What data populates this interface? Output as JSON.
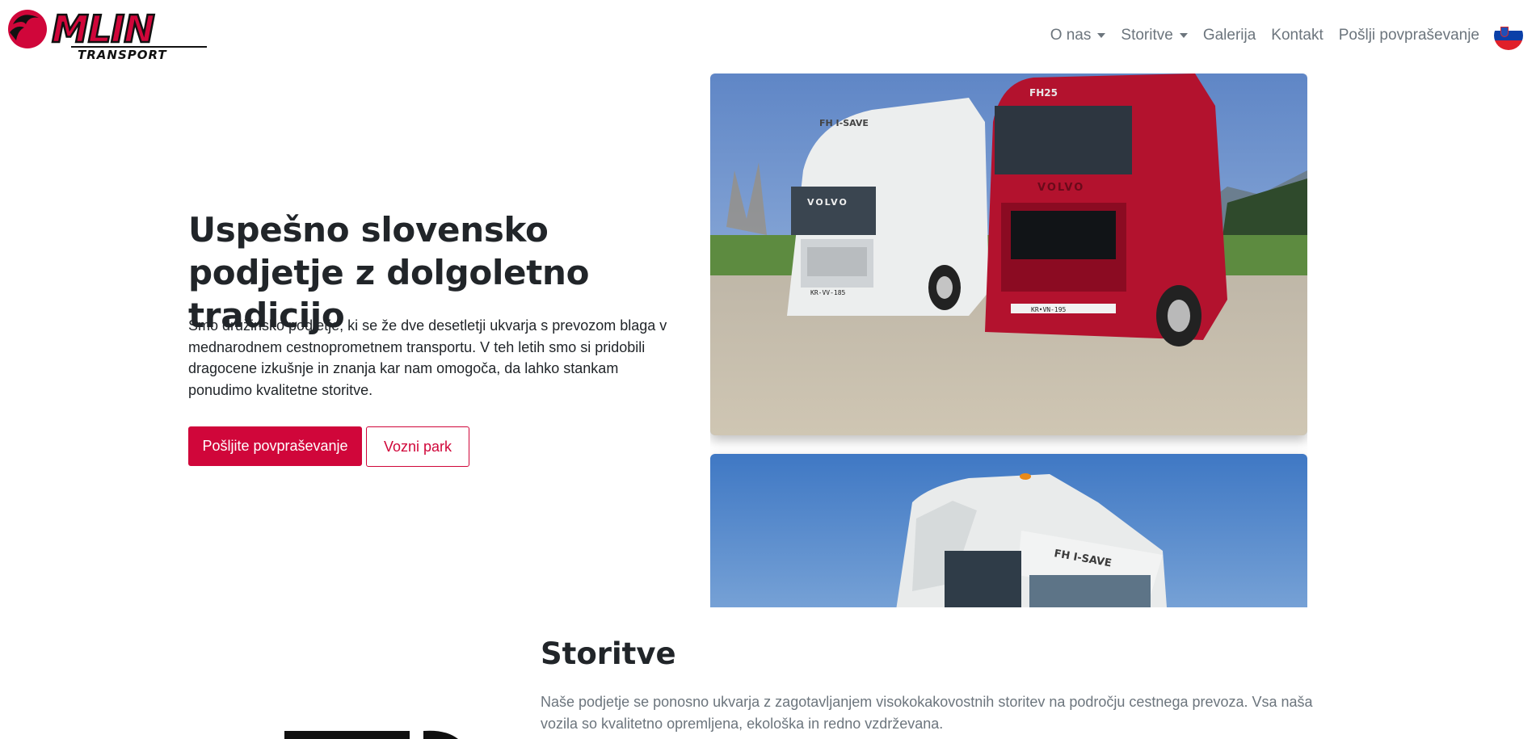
{
  "brand": {
    "logo_text": "MLIN",
    "logo_subtext": "TRANSPORT",
    "accent_color": "#d0063a"
  },
  "nav": {
    "items": [
      {
        "label": "O nas",
        "dropdown": true
      },
      {
        "label": "Storitve",
        "dropdown": true
      },
      {
        "label": "Galerija",
        "dropdown": false
      },
      {
        "label": "Kontakt",
        "dropdown": false
      },
      {
        "label": "Pošlji povpraševanje",
        "dropdown": false
      }
    ],
    "language_icon": "slovenia-flag-icon"
  },
  "hero": {
    "title": "Uspešno slovensko podjetje z dolgoletno tradicijo",
    "text": "Smo družinsko podjetje, ki se že dve desetletji ukvarja s prevozom blaga v mednarodnem cestnoprometnem transportu. V teh letih smo si pridobili dragocene izkušnje in znanja kar nam omogoča, da lahko stankam ponudimo kvalitetne storitve.",
    "primary_button": "Pošljite povpraševanje",
    "secondary_button": "Vozni park"
  },
  "gallery": {
    "photo1_trucks": [
      {
        "brand": "VOLVO",
        "badge": "FH I-SAVE",
        "plate": "KR-VV-185"
      },
      {
        "brand": "VOLVO",
        "badge": "FH25",
        "plate": "KR•VN-195"
      }
    ],
    "photo2_badge": "FH I-SAVE"
  },
  "services": {
    "title": "Storitve",
    "text": "Naše podjetje se ponosno ukvarja z zagotavljanjem visokokakovostnih storitev na področju cestnega prevoza. Vsa naša vozila so kvalitetno opremljena, ekološka in redno vzdrževana."
  }
}
